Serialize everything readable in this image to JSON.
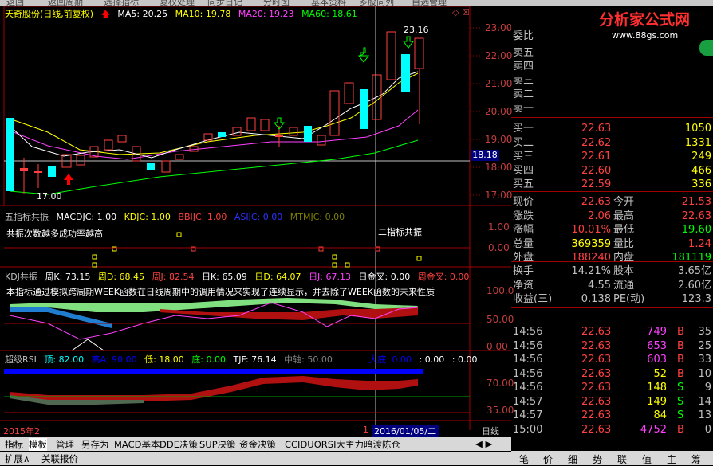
{
  "top_menu": [
    "返回",
    "返回周期",
    "选择指标",
    "复权处理",
    "同步日记",
    "分时图",
    "基本资料",
    "多股同列",
    "自选管理"
  ],
  "main": {
    "title": "天奇股份(日线,前复权)",
    "ma5": "MA5: 20.25",
    "ma10": "MA10: 19.78",
    "ma20": "MA20: 19.23",
    "ma60": "MA60: 18.61",
    "price_high": "23.16",
    "price_low": "17.00",
    "cursor_price": "18.18",
    "axis": [
      "23.00",
      "22.00",
      "21.00",
      "20.00",
      "19.00",
      "18.00",
      "17.00"
    ]
  },
  "p2": {
    "title": "五指标共振",
    "v1": "MACDJC: 1.00",
    "v2": "KDJC: 1.00",
    "v3": "BBIJC: 1.00",
    "v4": "ASIJC: 0.00",
    "v5": "MTMJC: 0.00",
    "note": "共振次数越多成功率越高",
    "note2": "二指标共振",
    "axis": [
      "1.00",
      "0.00"
    ]
  },
  "p3": {
    "title": "KDJ共振",
    "k1": "周K: 73.15",
    "d1": "周D: 68.45",
    "j1": "周J: 82.54",
    "k2": "日K: 65.09",
    "d2": "日D: 64.07",
    "j2": "日J: 67.13",
    "g1": "日金叉: 0.00",
    "g2": "周金叉: 0.00",
    "note": "本指标通过模拟跨周期WEEK函数在日线周期中的调用情况来实现了连续显示，并去除了WEEK函数的未来性质",
    "axis": [
      "100.0",
      "50.00",
      "0.00"
    ]
  },
  "p4": {
    "title": "超级RSI",
    "top": "顶: 82.00",
    "high": "高A: 90.00",
    "low": "低: 18.00",
    "bottom": "底: 0.00",
    "tjf": "TJF: 76.14",
    "mid": "中轴: 50.00",
    "big_bottom": "大底: 0.00",
    "v1": ": 0.00",
    "v2": ": 0.00",
    "axis": [
      "70.00",
      "35.00"
    ]
  },
  "date_bar": {
    "left": "2015年2",
    "mark": "1",
    "date": "2016/01/05/二",
    "period": "日线"
  },
  "tabs": [
    "指标",
    "模板",
    "管理",
    "另存为",
    "MACD基本",
    "DDE决策",
    "SUP决策",
    "资金决策",
    "CCIDUORSI大主力暗渡陈仓"
  ],
  "tabs2": [
    "扩展∧",
    "关联报价"
  ],
  "brand": {
    "name": "分析家公式网",
    "url": "www.88gs.com"
  },
  "order_book": {
    "wei_bi": "委比",
    "sells": [
      "卖五",
      "卖四",
      "卖三",
      "卖二",
      "卖一"
    ],
    "buys": [
      {
        "label": "买一",
        "price": "22.63",
        "vol": "1050"
      },
      {
        "label": "买二",
        "price": "22.62",
        "vol": "1331"
      },
      {
        "label": "买三",
        "price": "22.61",
        "vol": "249"
      },
      {
        "label": "买四",
        "price": "22.60",
        "vol": "466"
      },
      {
        "label": "买五",
        "price": "22.59",
        "vol": "336"
      }
    ]
  },
  "quote": [
    {
      "l": "现价",
      "v": "22.63",
      "l2": "今开",
      "v2": "21.53"
    },
    {
      "l": "涨跌",
      "v": "2.06",
      "l2": "最高",
      "v2": "22.63"
    },
    {
      "l": "涨幅",
      "v": "10.01%",
      "l2": "最低",
      "v2": "19.60"
    },
    {
      "l": "总量",
      "v": "369359",
      "l2": "量比",
      "v2": "1.24"
    },
    {
      "l": "外盘",
      "v": "188240",
      "l2": "内盘",
      "v2": "181119"
    }
  ],
  "stats": [
    {
      "l": "换手",
      "v": "14.21%",
      "l2": "股本",
      "v2": "3.65亿"
    },
    {
      "l": "净资",
      "v": "4.55",
      "l2": "流通",
      "v2": "2.60亿"
    },
    {
      "l": "收益(三)",
      "v": "0.138",
      "l2": "PE(动)",
      "v2": "123.3"
    }
  ],
  "ticks": [
    {
      "t": "14:56",
      "p": "22.63",
      "v": "749",
      "d": "B",
      "n": "35"
    },
    {
      "t": "14:56",
      "p": "22.63",
      "v": "653",
      "d": "B",
      "n": "25"
    },
    {
      "t": "14:56",
      "p": "22.63",
      "v": "603",
      "d": "B",
      "n": "33"
    },
    {
      "t": "14:56",
      "p": "22.63",
      "v": "52",
      "d": "B",
      "n": "10"
    },
    {
      "t": "14:56",
      "p": "22.63",
      "v": "148",
      "d": "S",
      "n": "9"
    },
    {
      "t": "14:57",
      "p": "22.63",
      "v": "149",
      "d": "S",
      "n": "14"
    },
    {
      "t": "14:57",
      "p": "22.63",
      "v": "84",
      "d": "S",
      "n": "13"
    },
    {
      "t": "15:00",
      "p": "22.63",
      "v": "4752",
      "d": "B",
      "n": "0"
    }
  ],
  "rtabs": [
    "笔",
    "价",
    "细",
    "势",
    "联",
    "值",
    "主",
    "筹"
  ],
  "colors": {
    "up": "#ff4040",
    "down": "#00ffff",
    "ma5": "#ffffff",
    "ma10": "#ffff00",
    "ma20": "#ff40ff",
    "ma60": "#00ff00"
  }
}
